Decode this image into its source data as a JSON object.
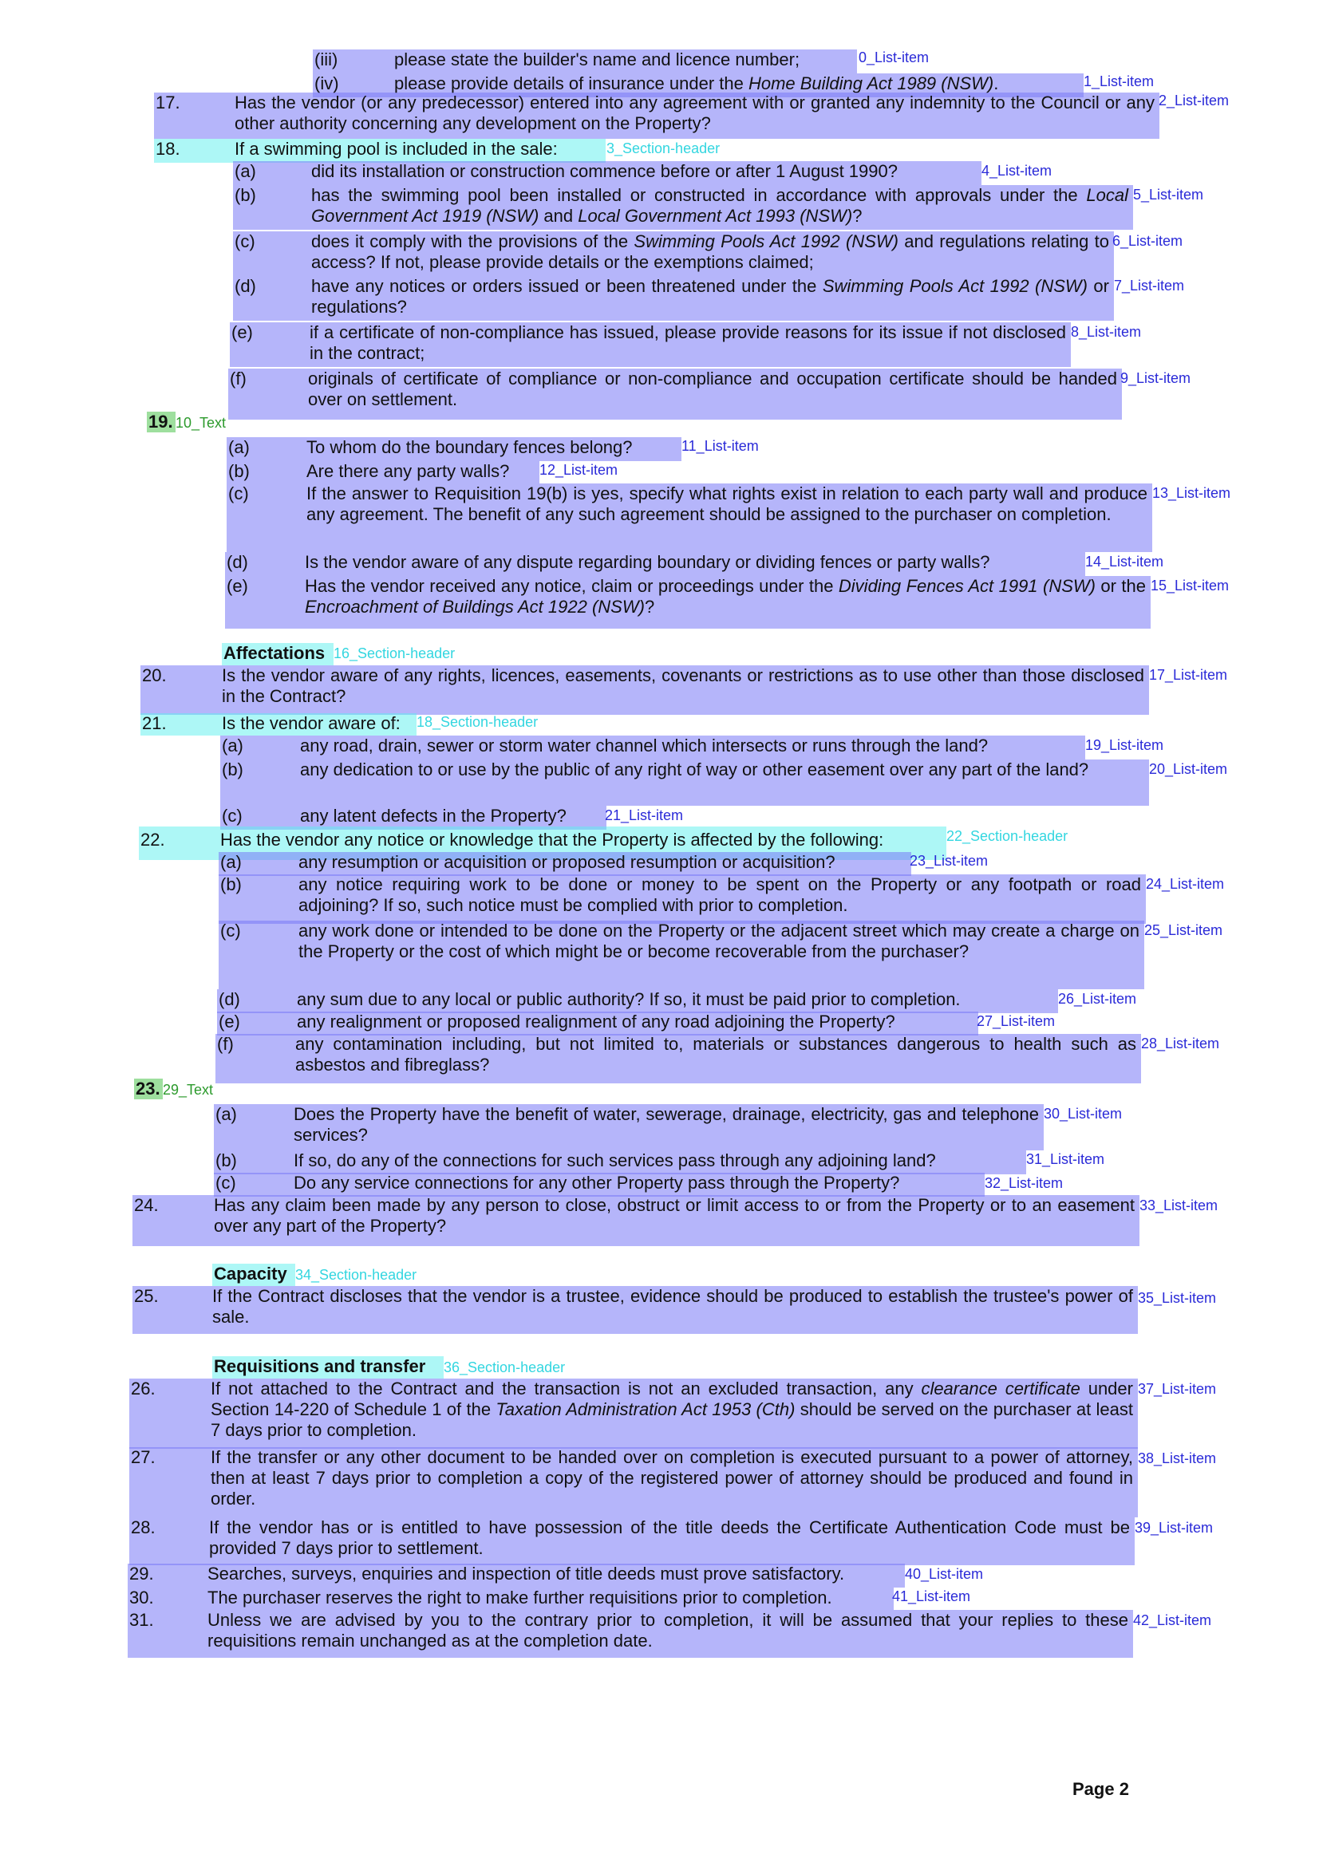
{
  "top_list": [
    {
      "num": "(iii)",
      "text": "please state the builder's name and licence number;",
      "tag": "0_List-item"
    },
    {
      "num": "(iv)",
      "text": "please provide details of insurance under the Home Building Act 1989 (NSW).",
      "tag": "1_List-item"
    }
  ],
  "req17": {
    "num": "17.",
    "text": "Has the vendor (or any predecessor) entered into any agreement with or granted any indemnity to the Council or any other authority concerning any development on the Property?",
    "tag": "2_List-item"
  },
  "req18": {
    "num": "18.",
    "text": "If a swimming pool is included in the sale:",
    "tag": "3_Section-header",
    "items": [
      {
        "num": "(a)",
        "text": "did its installation or construction commence before or after 1 August 1990?",
        "tag": "4_List-item"
      },
      {
        "num": "(b)",
        "text": "has the swimming pool been installed or constructed in accordance with approvals under the Local Government Act 1919 (NSW) and Local Government Act 1993 (NSW)?",
        "tag": "5_List-item"
      },
      {
        "num": "(c)",
        "text": "does it comply with the provisions of the Swimming Pools Act 1992 (NSW) and regulations relating to access? If not, please provide details or the exemptions claimed;",
        "tag": "6_List-item"
      },
      {
        "num": "(d)",
        "text": "have any notices or orders issued or been threatened under the Swimming Pools Act 1992 (NSW) or regulations?",
        "tag": "7_List-item"
      },
      {
        "num": "(e)",
        "text": "if a certificate of non-compliance has issued, please provide reasons for its issue if not disclosed in the contract;",
        "tag": "8_List-item"
      },
      {
        "num": "(f)",
        "text": "originals of certificate of compliance or non-compliance and occupation certificate should be handed over on settlement.",
        "tag": "9_List-item"
      }
    ]
  },
  "req19": {
    "num": "19.",
    "tag": "10_Text",
    "items": [
      {
        "num": "(a)",
        "text": "To whom do the boundary fences belong?",
        "tag": "11_List-item"
      },
      {
        "num": "(b)",
        "text": "Are there any party walls?",
        "tag": "12_List-item"
      },
      {
        "num": "(c)",
        "text": "If the answer to Requisition 19(b) is yes, specify what rights exist in relation to each party wall and produce any agreement. The benefit of any such agreement should be assigned to the purchaser on completion.",
        "tag": "13_List-item"
      },
      {
        "num": "(d)",
        "text": "Is the vendor aware of any dispute regarding boundary or dividing fences or party walls?",
        "tag": "14_List-item"
      },
      {
        "num": "(e)",
        "text": "Has the vendor received any notice, claim or proceedings under the Dividing Fences Act 1991 (NSW) or the Encroachment of Buildings Act 1922 (NSW)?",
        "tag": "15_List-item"
      }
    ]
  },
  "affectations": {
    "text": "Affectations",
    "tag": "16_Section-header"
  },
  "req20": {
    "num": "20.",
    "text": "Is the vendor aware of any rights, licences, easements, covenants or restrictions as to use other than those disclosed in the Contract?",
    "tag": "17_List-item"
  },
  "req21": {
    "num": "21.",
    "text": "Is the vendor aware of:",
    "tag": "18_Section-header",
    "items": [
      {
        "num": "(a)",
        "text": "any road, drain, sewer or storm water channel which intersects or runs through the land?",
        "tag": "19_List-item"
      },
      {
        "num": "(b)",
        "text": "any dedication to or use by the public of any right of way or other easement over any part of the land?",
        "tag": "20_List-item"
      },
      {
        "num": "(c)",
        "text": "any latent defects in the Property?",
        "tag": "21_List-item"
      }
    ]
  },
  "req22": {
    "num": "22.",
    "text": "Has the vendor any notice or knowledge that the Property is affected by the following:",
    "tag": "22_Section-header",
    "items": [
      {
        "num": "(a)",
        "text": "any resumption or acquisition or proposed resumption or acquisition?",
        "tag": "23_List-item"
      },
      {
        "num": "(b)",
        "text": "any notice requiring work to be done or money to be spent on the Property or any footpath or road adjoining? If so, such notice must be complied with prior to completion.",
        "tag": "24_List-item"
      },
      {
        "num": "(c)",
        "text": "any work done or intended to be done on the Property or the adjacent street which may create a charge on the Property or the cost of which might be or become recoverable from the purchaser?",
        "tag": "25_List-item"
      },
      {
        "num": "(d)",
        "text": "any sum due to any local or public authority? If so, it must be paid prior to completion.",
        "tag": "26_List-item"
      },
      {
        "num": "(e)",
        "text": "any realignment or proposed realignment of any road adjoining the Property?",
        "tag": "27_List-item"
      },
      {
        "num": "(f)",
        "text": "any contamination including, but not limited to, materials or substances dangerous to health such as asbestos and fibreglass?",
        "tag": "28_List-item"
      }
    ]
  },
  "req23": {
    "num": "23.",
    "tag": "29_Text",
    "items": [
      {
        "num": "(a)",
        "text": "Does the Property have the benefit of water, sewerage, drainage, electricity, gas and telephone services?",
        "tag": "30_List-item"
      },
      {
        "num": "(b)",
        "text": "If so, do any of the connections for such services pass through any adjoining land?",
        "tag": "31_List-item"
      },
      {
        "num": "(c)",
        "text": "Do any service connections for any other Property pass through the Property?",
        "tag": "32_List-item"
      }
    ]
  },
  "req24": {
    "num": "24.",
    "text": "Has any claim been made by any person to close, obstruct or limit access to or from the Property or to an easement over any part of the Property?",
    "tag": "33_List-item"
  },
  "capacity": {
    "text": "Capacity",
    "tag": "34_Section-header"
  },
  "req25": {
    "num": "25.",
    "text": "If the Contract discloses that the vendor is a trustee, evidence should be produced to establish the trustee's power of sale.",
    "tag": "35_List-item"
  },
  "req_transfer": {
    "text": "Requisitions and transfer",
    "tag": "36_Section-header"
  },
  "req26": {
    "num": "26.",
    "text": "If not attached to the Contract and the transaction is not an excluded transaction, any clearance certificate under Section 14-220 of Schedule 1 of the Taxation Administration Act 1953 (Cth) should be served on the purchaser at least 7 days prior to completion.",
    "tag": "37_List-item"
  },
  "req27": {
    "num": "27.",
    "text": "If the transfer or any other document to be handed over on completion is executed pursuant to a power of attorney, then at least 7 days prior to completion a copy of the registered power of attorney should be produced and found in order.",
    "tag": "38_List-item"
  },
  "req28": {
    "num": "28.",
    "text": "If the vendor has or is entitled to have possession of the title deeds the Certificate Authentication Code must be provided 7 days prior to settlement.",
    "tag": "39_List-item"
  },
  "req29": {
    "num": "29.",
    "text": "Searches, surveys, enquiries and inspection of title deeds must prove satisfactory.",
    "tag": "40_List-item"
  },
  "req30": {
    "num": "30.",
    "text": "The purchaser reserves the right to make further requisitions prior to completion.",
    "tag": "41_List-item"
  },
  "req31": {
    "num": "31.",
    "text": "Unless we are advised by you to the contrary prior to completion, it will be assumed that your replies to these requisitions remain unchanged as at the completion date.",
    "tag": "42_List-item"
  },
  "page_label": "Page 2"
}
